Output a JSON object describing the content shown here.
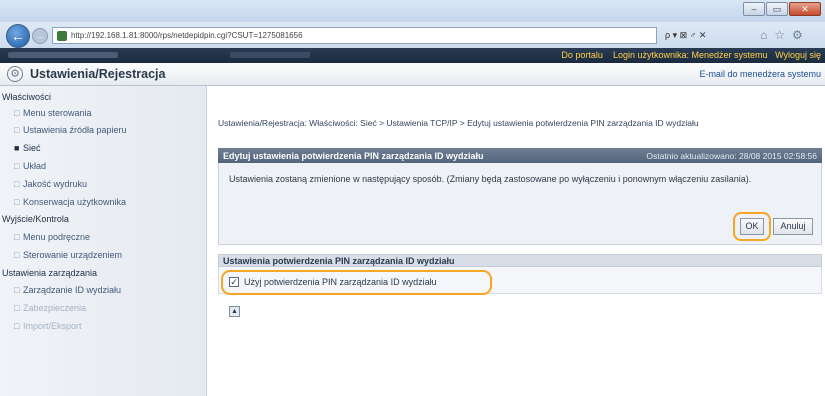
{
  "browser": {
    "url": "http://192.168.1.81:8000/rps/netdepidpin.cgi?CSUT=1275081656",
    "search_controls": "ρ ▾ ⊠ ♂ ✕",
    "window_buttons": {
      "minimize": "–",
      "maximize": "▭",
      "close": "✕"
    },
    "back_glyph": "←",
    "forward_glyph": "→",
    "toolbar_icons": {
      "home": "⌂",
      "favorites": "☆",
      "settings": "⚙"
    }
  },
  "portal_bar": {
    "to_portal": "Do portalu",
    "login_user_label": "Login użytkownika:",
    "login_user_value": "Menedżer systemu",
    "logout": "Wyloguj się"
  },
  "app": {
    "icon_glyph": "⚙",
    "title": "Ustawienia/Rejestracja",
    "email_link": "E-mail do menedżera systemu"
  },
  "sidebar": {
    "sections": [
      {
        "heading": "Właściwości",
        "items": [
          {
            "label": "Menu sterowania"
          },
          {
            "label": "Ustawienia źródła papieru"
          },
          {
            "label": "Sieć"
          },
          {
            "label": "Układ"
          },
          {
            "label": "Jakość wydruku"
          },
          {
            "label": "Konserwacja użytkownika"
          }
        ]
      },
      {
        "heading": "Wyjście/Kontrola",
        "items": [
          {
            "label": "Menu podręczne"
          },
          {
            "label": "Sterowanie urządzeniem"
          }
        ]
      },
      {
        "heading": "Ustawienia zarządzania",
        "items": [
          {
            "label": "Zarządzanie ID wydziału"
          },
          {
            "label": "Zabezpieczenia"
          },
          {
            "label": "Import/Eksport"
          }
        ]
      }
    ]
  },
  "breadcrumb": "Ustawienia/Rejestracja: Właściwości: Sieć > Ustawienia TCP/IP > Edytuj ustawienia potwierdzenia PIN zarządzania ID wydziału",
  "panel": {
    "title": "Edytuj ustawienia potwierdzenia PIN zarządzania ID wydziału",
    "updated": "Ostatnio aktualizowano: 28/08 2015 02:58:56",
    "message": "Ustawienia zostaną zmienione w następujący sposób. (Zmiany będą zastosowane po wyłączeniu i ponownym włączeniu zasilania).",
    "ok_label": "OK",
    "cancel_label": "Anuluj"
  },
  "section": {
    "title": "Ustawienia potwierdzenia PIN zarządzania ID wydziału",
    "checkbox_label": "Użyj potwierdzenia PIN zarządzania ID wydziału",
    "checkbox_checked": true,
    "checkbox_mark": "✓"
  },
  "top_arrow_glyph": "▲"
}
